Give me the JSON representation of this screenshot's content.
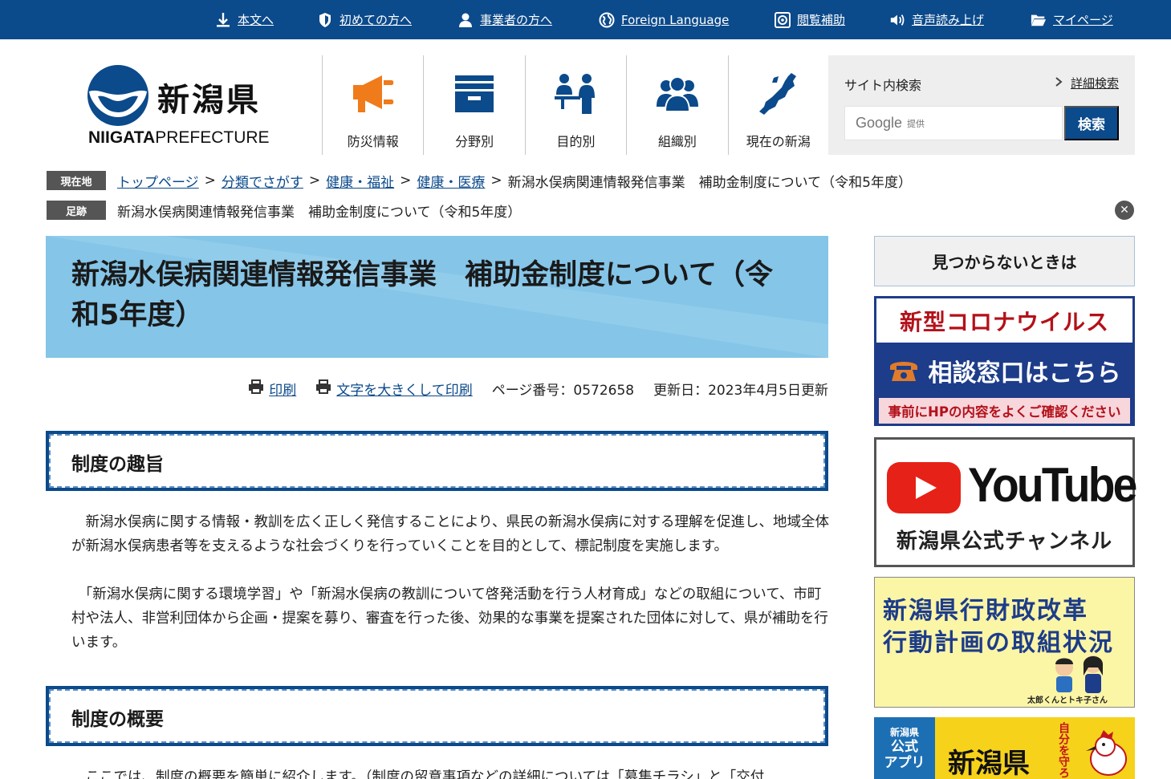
{
  "topbar": {
    "links": [
      {
        "label": "本文へ",
        "icon": "download-arrow-icon"
      },
      {
        "label": "初めての方へ",
        "icon": "shield-icon"
      },
      {
        "label": "事業者の方へ",
        "icon": "person-icon"
      },
      {
        "label": "Foreign Language",
        "icon": "globe-icon"
      },
      {
        "label": "閲覧補助",
        "icon": "accessibility-icon"
      },
      {
        "label": "音声読み上げ",
        "icon": "speaker-icon"
      },
      {
        "label": "マイページ",
        "icon": "folder-icon"
      }
    ]
  },
  "header": {
    "logo_jp": "新潟県",
    "logo_en_bold": "NIIGATA",
    "logo_en_rest": "PREFECTURE",
    "nav": [
      {
        "label": "防災情報",
        "icon": "megaphone-icon"
      },
      {
        "label": "分野別",
        "icon": "tray-icon"
      },
      {
        "label": "目的別",
        "icon": "people-desk-icon"
      },
      {
        "label": "組織別",
        "icon": "group-icon"
      },
      {
        "label": "現在の新潟",
        "icon": "niigata-map-icon"
      }
    ],
    "search": {
      "title": "サイト内検索",
      "detail": "詳細検索",
      "google": "Google",
      "provided": "提供",
      "button": "検索"
    }
  },
  "breadcrumb": {
    "tag": "現在地",
    "links": [
      "トップページ",
      "分類でさがす",
      "健康・福祉",
      "健康・医療"
    ],
    "current": "新潟水俣病関連情報発信事業　補助金制度について（令和5年度）"
  },
  "footprint": {
    "tag": "足跡",
    "text": "新潟水俣病関連情報発信事業　補助金制度について（令和5年度）"
  },
  "page": {
    "title": "新潟水俣病関連情報発信事業　補助金制度について（令和5年度）",
    "print": "印刷",
    "print_large": "文字を大きくして印刷",
    "page_number": "ページ番号：0572658",
    "updated": "更新日：2023年4月5日更新"
  },
  "sections": [
    {
      "heading": "制度の趣旨",
      "paragraphs": [
        "　新潟水俣病に関する情報・教訓を広く正しく発信することにより、県民の新潟水俣病に対する理解を促進し、地域全体が新潟水俣病患者等を支えるような社会づくりを行っていくことを目的として、標記制度を実施します。",
        "　「新潟水俣病に関する環境学習」や「新潟水俣病の教訓について啓発活動を行う人材育成」などの取組について、市町村や法人、非営利団体から企画・提案を募り、審査を行った後、効果的な事業を提案された団体に対して、県が補助を行います。"
      ]
    },
    {
      "heading": "制度の概要",
      "paragraphs": [
        "　ここでは、制度の概要を簡単に紹介します。（制度の留意事項などの詳細については「募集チラシ」と「交付"
      ]
    }
  ],
  "sidebar": {
    "notfound": "見つからないときは",
    "covid": {
      "line1": "新型コロナウイルス",
      "line2": "相談窓口はこちら",
      "line3": "事前にHPの内容をよくご確認ください"
    },
    "youtube": {
      "word": "YouTube",
      "sub": "新潟県公式チャンネル"
    },
    "reform": {
      "line1": "新潟県行財政改革",
      "line2": "行動計画の取組状況",
      "caption": "太郎くんとトキ子さん"
    },
    "app": {
      "small": "新潟県",
      "line2": "公式",
      "line3": "アプリ",
      "big": "新潟県",
      "side": "自分を守ろう"
    }
  },
  "colors": {
    "brand_blue": "#0b4a8b",
    "title_bg": "#85c5e8",
    "covid_red": "#b3111a",
    "orange_icon": "#f07b1a"
  }
}
